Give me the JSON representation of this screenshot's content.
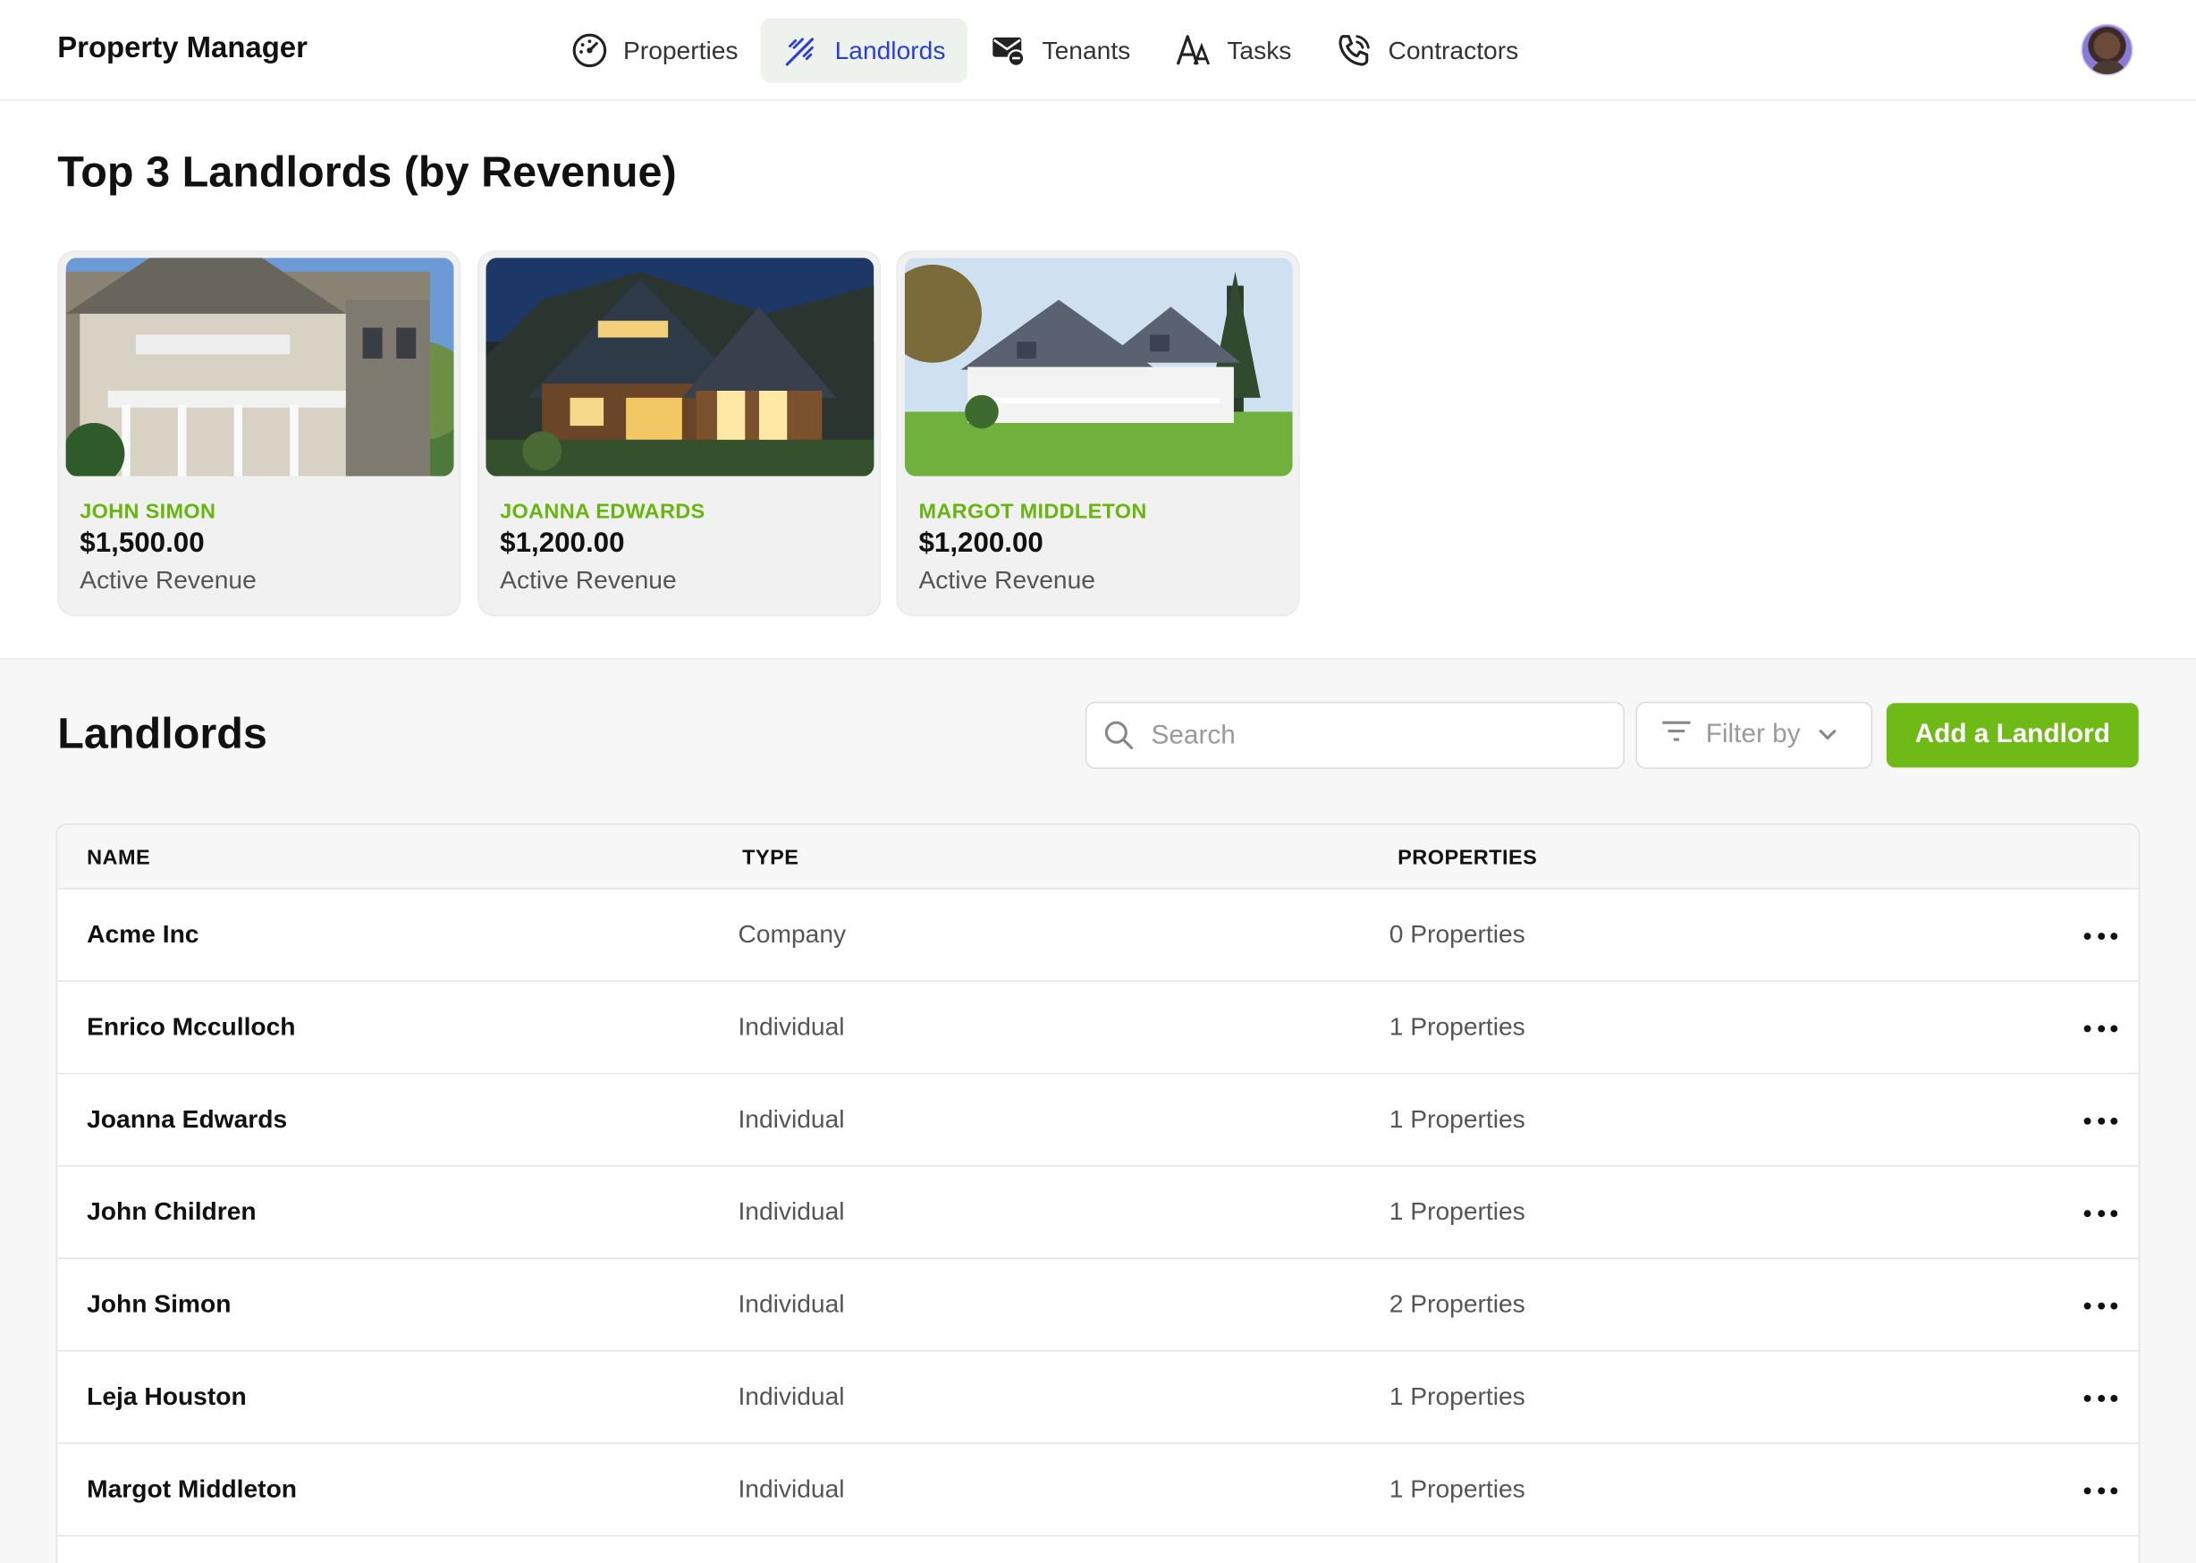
{
  "app": {
    "title": "Property Manager"
  },
  "nav": {
    "items": [
      {
        "label": "Properties",
        "icon": "dashboard-gauge-icon",
        "active": false
      },
      {
        "label": "Landlords",
        "icon": "feather-pen-icon",
        "active": true
      },
      {
        "label": "Tenants",
        "icon": "mail-minus-icon",
        "active": false
      },
      {
        "label": "Tasks",
        "icon": "text-font-icon",
        "active": false
      },
      {
        "label": "Contractors",
        "icon": "phone-ringing-icon",
        "active": false
      }
    ]
  },
  "top_landlords": {
    "title": "Top 3 Landlords (by Revenue)",
    "cards": [
      {
        "name": "JOHN SIMON",
        "amount": "$1,500.00",
        "caption": "Active Revenue",
        "photo": "victorian-house-photo"
      },
      {
        "name": "JOANNA EDWARDS",
        "amount": "$1,200.00",
        "caption": "Active Revenue",
        "photo": "night-lodge-house-photo"
      },
      {
        "name": "MARGOT MIDDLETON",
        "amount": "$1,200.00",
        "caption": "Active Revenue",
        "photo": "white-farmhouse-photo"
      }
    ]
  },
  "landlords": {
    "title": "Landlords",
    "search_placeholder": "Search",
    "filter_label": "Filter by",
    "add_button": "Add a Landlord",
    "columns": {
      "name": "NAME",
      "type": "TYPE",
      "properties": "PROPERTIES"
    },
    "rows": [
      {
        "name": "Acme Inc",
        "type": "Company",
        "properties": "0 Properties"
      },
      {
        "name": "Enrico Mcculloch",
        "type": "Individual",
        "properties": "1 Properties"
      },
      {
        "name": "Joanna Edwards",
        "type": "Individual",
        "properties": "1 Properties"
      },
      {
        "name": "John Children",
        "type": "Individual",
        "properties": "1 Properties"
      },
      {
        "name": "John Simon",
        "type": "Individual",
        "properties": "2 Properties"
      },
      {
        "name": "Leja Houston",
        "type": "Individual",
        "properties": "1 Properties"
      },
      {
        "name": "Margot Middleton",
        "type": "Individual",
        "properties": "1 Properties"
      }
    ]
  },
  "colors": {
    "accent_green": "#6fba16",
    "nav_active": "#2b3fd6",
    "name_green": "#69b50f"
  }
}
